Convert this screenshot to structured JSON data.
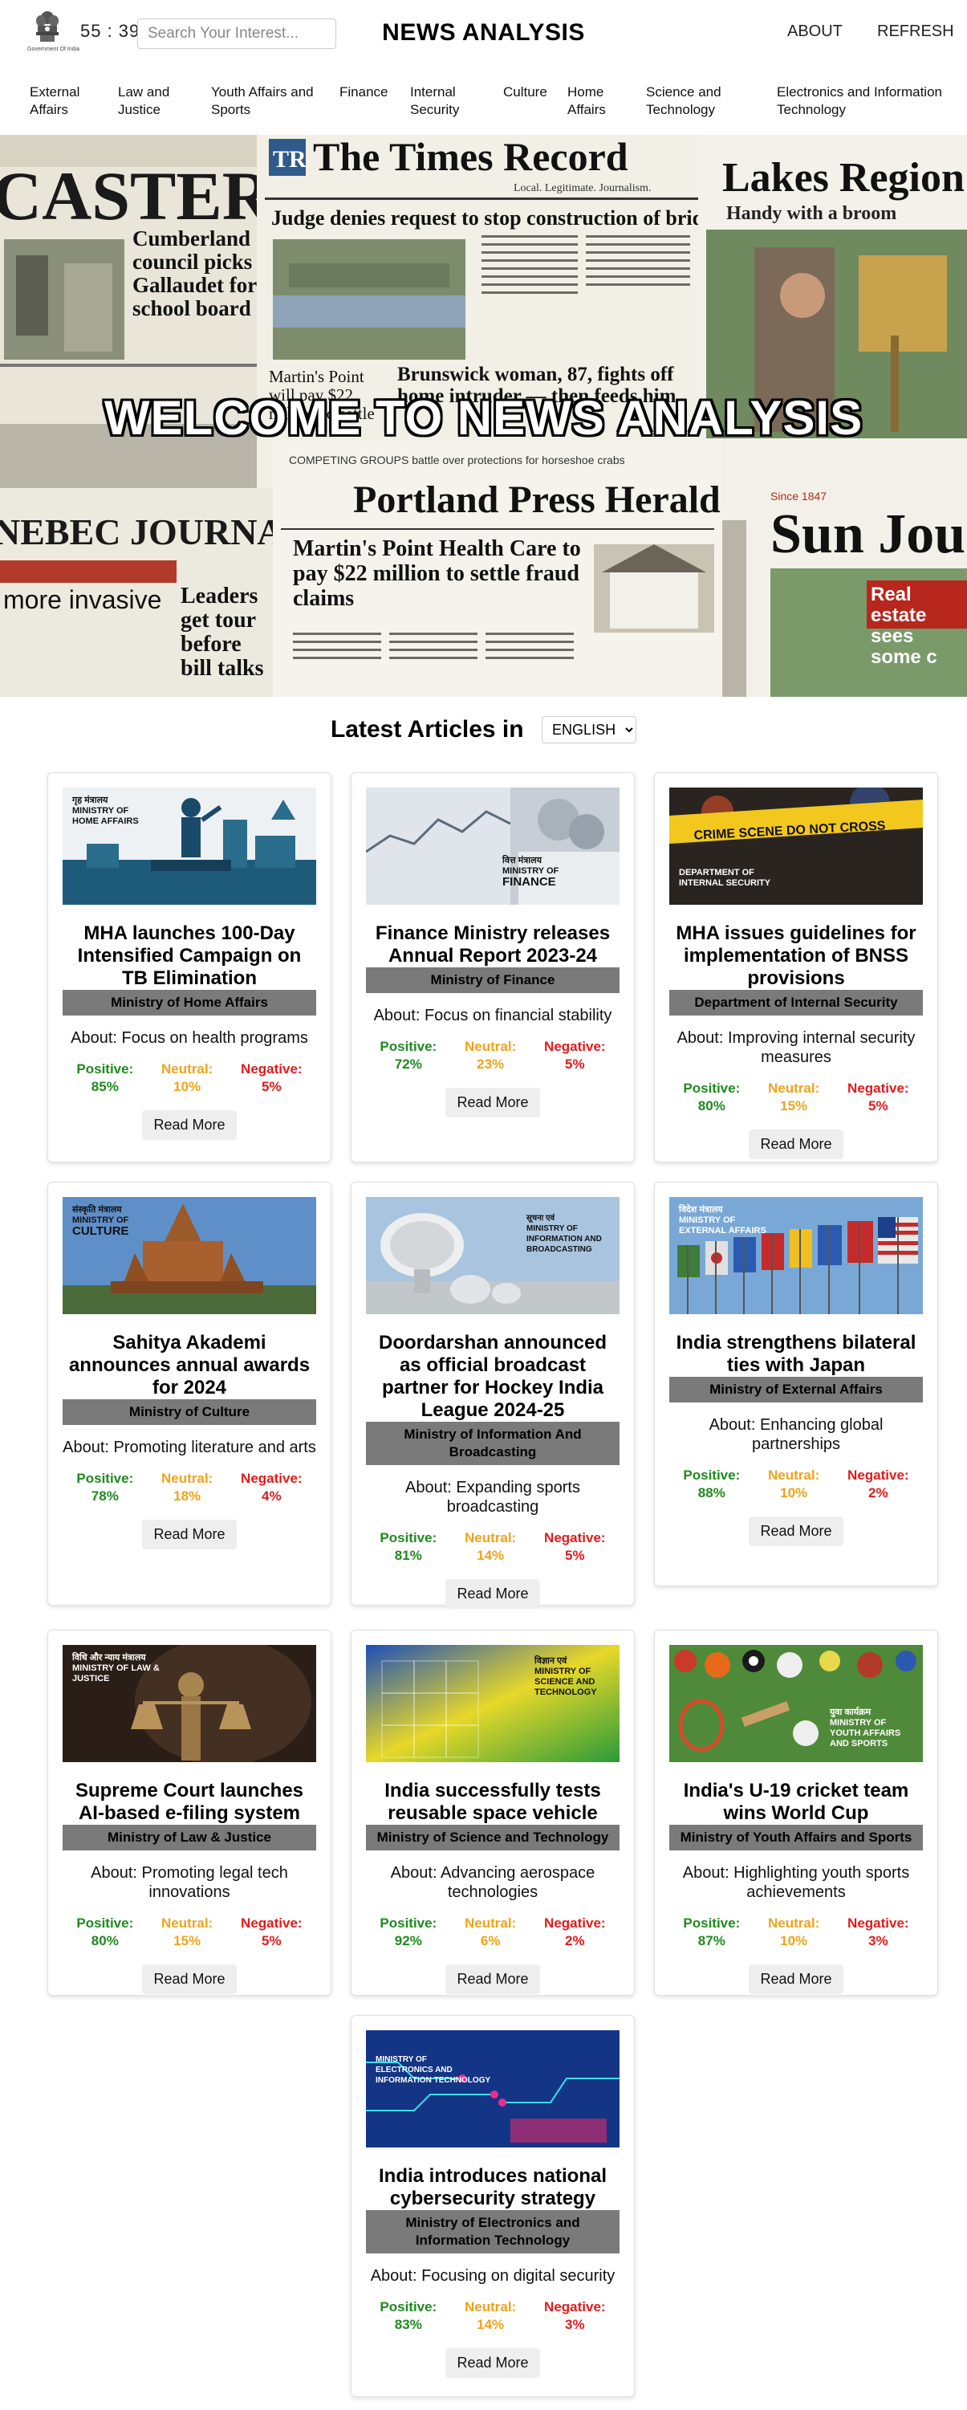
{
  "header": {
    "emblem_caption": "Government Of India",
    "timer": "55 : 39",
    "search_placeholder": "Search Your Interest...",
    "title": "NEWS ANALYSIS",
    "about": "ABOUT",
    "refresh": "REFRESH"
  },
  "nav": [
    "External Affairs",
    "Law and Justice",
    "Youth Affairs and Sports",
    "Finance",
    "Internal Security",
    "Culture",
    "Home Affairs",
    "Science and Technology",
    "Electronics and Information Technology"
  ],
  "hero": {
    "title": "WELCOME TO NEWS ANALYSIS",
    "paper_times": "The Times Record",
    "paper_times_tag": "Local. Legitimate. Journalism.",
    "paper_times_headline": "Judge denies request to stop construction of bridge",
    "paper_times_story1": "Martin's Point will pay $22 million to settle",
    "paper_times_story2": "Brunswick woman, 87, fights off home intruder — then feeds him",
    "paper_lakes": "Lakes Region",
    "paper_lakes_sub": "Handy with a broom",
    "paper_caster": "CASTER",
    "paper_caster_headline": "Cumberland council picks Gallaudet for school board",
    "paper_portland": "Portland Press Herald",
    "paper_portland_topline": "COMPETING GROUPS battle over protections for horseshoe crabs",
    "paper_portland_headline": "Martin's Point Health Care to pay $22 million to settle fraud claims",
    "paper_kennebec": "NEBEC JOURNAL",
    "paper_kennebec_sub": "more invasive",
    "paper_leaders": "Leaders get tour before bill talks",
    "paper_sun": "Sun Jou",
    "paper_sun_since": "Since 1847",
    "paper_sun_story": "Real estate sees some c"
  },
  "latest": {
    "title": "Latest Articles in",
    "language": "ENGLISH"
  },
  "labels": {
    "positive": "Positive:",
    "neutral": "Neutral:",
    "negative": "Negative:",
    "read_more": "Read More"
  },
  "articles": [
    {
      "title": "MHA launches 100-Day Intensified Campaign on TB Elimination",
      "ministry": "Ministry of Home Affairs",
      "about": "About: Focus on health programs",
      "positive": "85%",
      "neutral": "10%",
      "negative": "5%",
      "logo": [
        "गृह मंत्रालय",
        "MINISTRY OF",
        "HOME AFFAIRS"
      ]
    },
    {
      "title": "Finance Ministry releases Annual Report 2023-24",
      "ministry": "Ministry of Finance",
      "about": "About: Focus on financial stability",
      "positive": "72%",
      "neutral": "23%",
      "negative": "5%",
      "logo": [
        "वित्त मंत्रालय",
        "MINISTRY OF",
        "FINANCE"
      ]
    },
    {
      "title": "MHA issues guidelines for implementation of BNSS provisions",
      "ministry": "Department of Internal Security",
      "about": "About: Improving internal security measures",
      "positive": "80%",
      "neutral": "15%",
      "negative": "5%",
      "logo": [
        "DEPARTMENT OF",
        "INTERNAL SECURITY"
      ],
      "tape": "CRIME SCENE DO NOT CROSS"
    },
    {
      "title": "Sahitya Akademi announces annual awards for 2024",
      "ministry": "Ministry of Culture",
      "about": "About: Promoting literature and arts",
      "positive": "78%",
      "neutral": "18%",
      "negative": "4%",
      "logo": [
        "संस्कृति मंत्रालय",
        "MINISTRY OF",
        "CULTURE"
      ]
    },
    {
      "title": "Doordarshan announced as official broadcast partner for Hockey India League 2024-25",
      "ministry": "Ministry of Information And Broadcasting",
      "about": "About: Expanding sports broadcasting",
      "positive": "81%",
      "neutral": "14%",
      "negative": "5%",
      "logo": [
        "सूचना एवं",
        "MINISTRY OF",
        "INFORMATION AND BROADCASTING"
      ]
    },
    {
      "title": "India strengthens bilateral ties with Japan",
      "ministry": "Ministry of External Affairs",
      "about": "About: Enhancing global partnerships",
      "positive": "88%",
      "neutral": "10%",
      "negative": "2%",
      "logo": [
        "विदेश मंत्रालय",
        "MINISTRY OF",
        "EXTERNAL AFFAIRS"
      ]
    },
    {
      "title": "Supreme Court launches AI-based e-filing system",
      "ministry": "Ministry of Law & Justice",
      "about": "About: Promoting legal tech innovations",
      "positive": "80%",
      "neutral": "15%",
      "negative": "5%",
      "logo": [
        "विधि और न्याय मंत्रालय",
        "MINISTRY OF LAW &",
        "JUSTICE"
      ]
    },
    {
      "title": "India successfully tests reusable space vehicle",
      "ministry": "Ministry of Science and Technology",
      "about": "About: Advancing aerospace technologies",
      "positive": "92%",
      "neutral": "6%",
      "negative": "2%",
      "logo": [
        "विज्ञान एवं",
        "MINISTRY OF",
        "SCIENCE AND TECHNOLOGY"
      ]
    },
    {
      "title": "India's U-19 cricket team wins World Cup",
      "ministry": "Ministry of Youth Affairs and Sports",
      "about": "About: Highlighting youth sports achievements",
      "positive": "87%",
      "neutral": "10%",
      "negative": "3%",
      "logo": [
        "युवा कार्यक्रम",
        "MINISTRY OF",
        "YOUTH AFFAIRS AND SPORTS"
      ]
    },
    {
      "title": "India introduces national cybersecurity strategy",
      "ministry": "Ministry of Electronics and Information Technology",
      "about": "About: Focusing on digital security",
      "positive": "83%",
      "neutral": "14%",
      "negative": "3%",
      "logo": [
        "MINISTRY OF",
        "ELECTRONICS AND",
        "INFORMATION TECHNOLOGY"
      ]
    }
  ]
}
